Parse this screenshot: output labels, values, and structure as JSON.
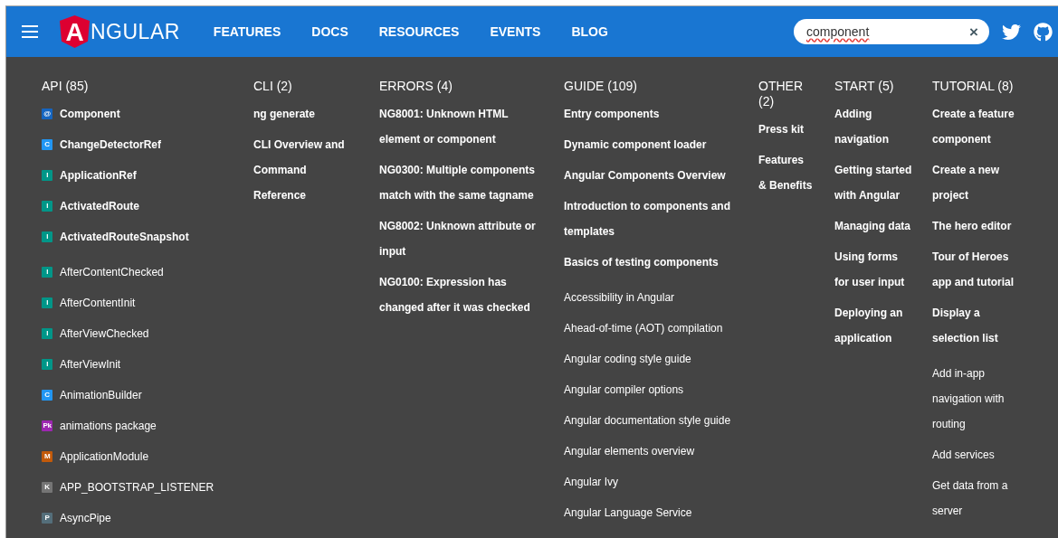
{
  "header": {
    "logo": {
      "initial": "A",
      "rest": "NGULAR"
    },
    "nav": [
      "FEATURES",
      "DOCS",
      "RESOURCES",
      "EVENTS",
      "BLOG"
    ],
    "search": {
      "value": "component",
      "misspelled": true,
      "clear": "×"
    }
  },
  "results": [
    {
      "title": "API (85)",
      "items": [
        {
          "label": "Component",
          "featured": true,
          "badge": "@",
          "color": "#1565c0"
        },
        {
          "label": "ChangeDetectorRef",
          "featured": true,
          "badge": "C",
          "color": "#2196f3"
        },
        {
          "label": "ApplicationRef",
          "featured": true,
          "badge": "I",
          "color": "#009688"
        },
        {
          "label": "ActivatedRoute",
          "featured": true,
          "badge": "I",
          "color": "#009688"
        },
        {
          "label": "ActivatedRouteSnapshot",
          "featured": true,
          "badge": "I",
          "color": "#009688"
        },
        {
          "label": "AfterContentChecked",
          "featured": false,
          "badge": "I",
          "color": "#009688"
        },
        {
          "label": "AfterContentInit",
          "featured": false,
          "badge": "I",
          "color": "#009688"
        },
        {
          "label": "AfterViewChecked",
          "featured": false,
          "badge": "I",
          "color": "#009688"
        },
        {
          "label": "AfterViewInit",
          "featured": false,
          "badge": "I",
          "color": "#009688"
        },
        {
          "label": "AnimationBuilder",
          "featured": false,
          "badge": "C",
          "color": "#2196f3"
        },
        {
          "label": "animations package",
          "featured": false,
          "badge": "Pk",
          "color": "#9c27b0"
        },
        {
          "label": "ApplicationModule",
          "featured": false,
          "badge": "M",
          "color": "#c25a0a"
        },
        {
          "label": "APP_BOOTSTRAP_LISTENER",
          "featured": false,
          "badge": "K",
          "color": "#757575"
        },
        {
          "label": "AsyncPipe",
          "featured": false,
          "badge": "P",
          "color": "#546e7a"
        }
      ]
    },
    {
      "title": "CLI (2)",
      "items": [
        {
          "label": "ng generate",
          "featured": true
        },
        {
          "label": "CLI Overview and Command Reference",
          "featured": true
        }
      ]
    },
    {
      "title": "ERRORS (4)",
      "items": [
        {
          "label": "NG8001: Unknown HTML element or component",
          "featured": true
        },
        {
          "label": "NG0300: Multiple components match with the same tagname",
          "featured": true
        },
        {
          "label": "NG8002: Unknown attribute or input",
          "featured": true
        },
        {
          "label": "NG0100: Expression has changed after it was checked",
          "featured": true
        }
      ]
    },
    {
      "title": "GUIDE (109)",
      "items": [
        {
          "label": "Entry components",
          "featured": true
        },
        {
          "label": "Dynamic component loader",
          "featured": true
        },
        {
          "label": "Angular Components Overview",
          "featured": true
        },
        {
          "label": "Introduction to components and templates",
          "featured": true
        },
        {
          "label": "Basics of testing components",
          "featured": true
        },
        {
          "label": "Accessibility in Angular",
          "featured": false
        },
        {
          "label": "Ahead-of-time (AOT) compilation",
          "featured": false
        },
        {
          "label": "Angular coding style guide",
          "featured": false
        },
        {
          "label": "Angular compiler options",
          "featured": false
        },
        {
          "label": "Angular documentation style guide",
          "featured": false
        },
        {
          "label": "Angular elements overview",
          "featured": false
        },
        {
          "label": "Angular Ivy",
          "featured": false
        },
        {
          "label": "Angular Language Service",
          "featured": false
        }
      ]
    },
    {
      "title": "OTHER (2)",
      "items": [
        {
          "label": "Press kit",
          "featured": true
        },
        {
          "label": "Features & Benefits",
          "featured": true
        }
      ]
    },
    {
      "title": "START (5)",
      "items": [
        {
          "label": "Adding navigation",
          "featured": true
        },
        {
          "label": "Getting started with Angular",
          "featured": true
        },
        {
          "label": "Managing data",
          "featured": true
        },
        {
          "label": "Using forms for user input",
          "featured": true
        },
        {
          "label": "Deploying an application",
          "featured": true
        }
      ]
    },
    {
      "title": "TUTORIAL (8)",
      "items": [
        {
          "label": "Create a feature component",
          "featured": true
        },
        {
          "label": "Create a new project",
          "featured": true
        },
        {
          "label": "The hero editor",
          "featured": true
        },
        {
          "label": "Tour of Heroes app and tutorial",
          "featured": true
        },
        {
          "label": "Display a selection list",
          "featured": true
        },
        {
          "label": "Add in-app navigation with routing",
          "featured": false
        },
        {
          "label": "Add services",
          "featured": false
        },
        {
          "label": "Get data from a server",
          "featured": false
        }
      ]
    }
  ]
}
